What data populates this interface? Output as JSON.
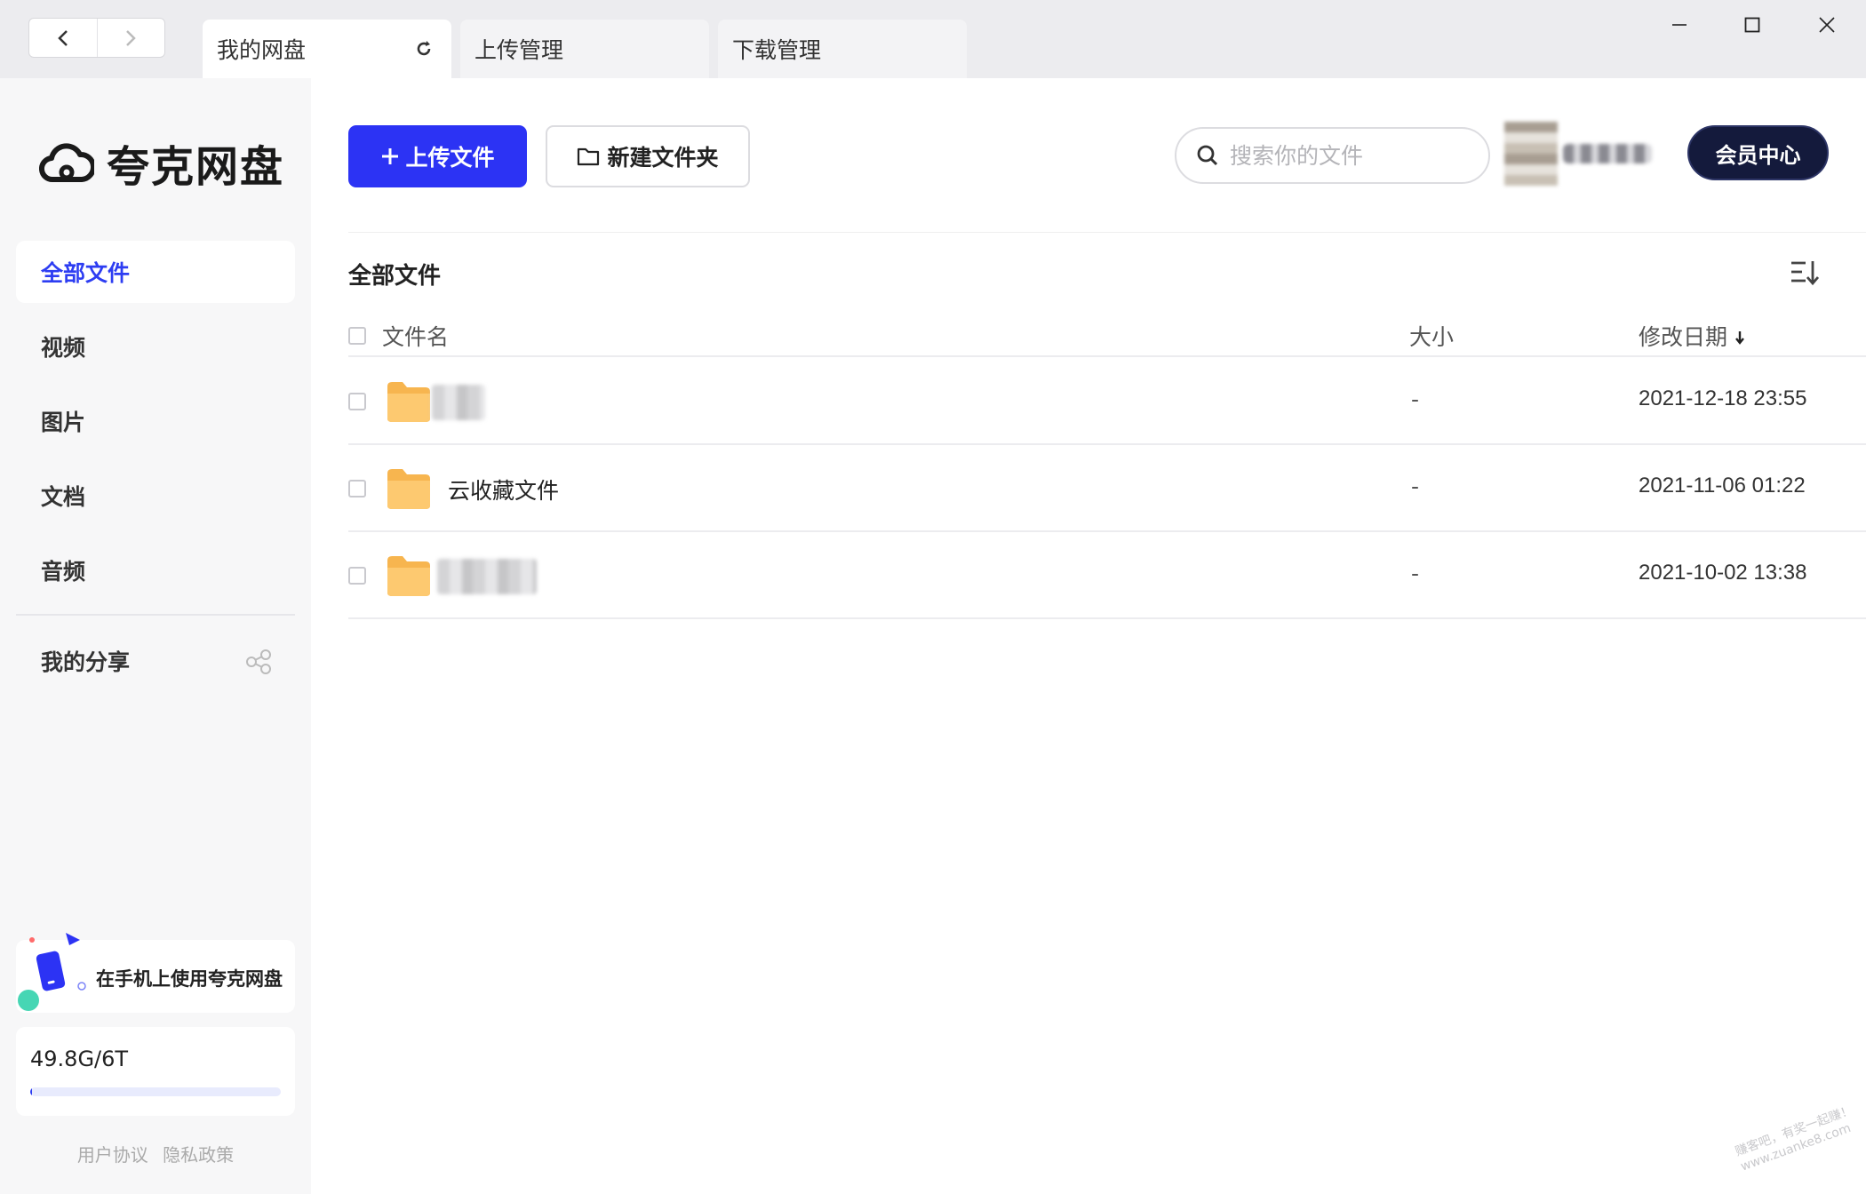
{
  "tabs": [
    {
      "label": "我的网盘",
      "active": true
    },
    {
      "label": "上传管理",
      "active": false
    },
    {
      "label": "下载管理",
      "active": false
    }
  ],
  "app": {
    "name": "夸克网盘"
  },
  "sidebar": {
    "items": [
      {
        "label": "全部文件",
        "active": true
      },
      {
        "label": "视频"
      },
      {
        "label": "图片"
      },
      {
        "label": "文档"
      },
      {
        "label": "音频"
      }
    ],
    "share_label": "我的分享",
    "promo_text": "在手机上使用夸克网盘",
    "storage_text": "49.8G/6T",
    "storage_used_fraction": 0.008,
    "footer_links": [
      "用户协议",
      "隐私政策"
    ]
  },
  "toolbar": {
    "upload_label": "上传文件",
    "new_folder_label": "新建文件夹",
    "search_placeholder": "搜索你的文件",
    "vip_label": "会员中心"
  },
  "main": {
    "section_title": "全部文件",
    "columns": {
      "name": "文件名",
      "size": "大小",
      "date": "修改日期"
    },
    "files": [
      {
        "name": "",
        "size": "-",
        "date": "2021-12-18 23:55"
      },
      {
        "name": "云收藏文件",
        "size": "-",
        "date": "2021-11-06 01:22"
      },
      {
        "name": "",
        "size": "-",
        "date": "2021-10-02 13:38"
      }
    ]
  },
  "colors": {
    "accent": "#2c33f4",
    "vip_bg": "#141a3c",
    "folder": "#fcc36a"
  },
  "watermark": {
    "lines": [
      "赚客吧，有奖一起赚！",
      "www.zuanke8.com"
    ]
  }
}
